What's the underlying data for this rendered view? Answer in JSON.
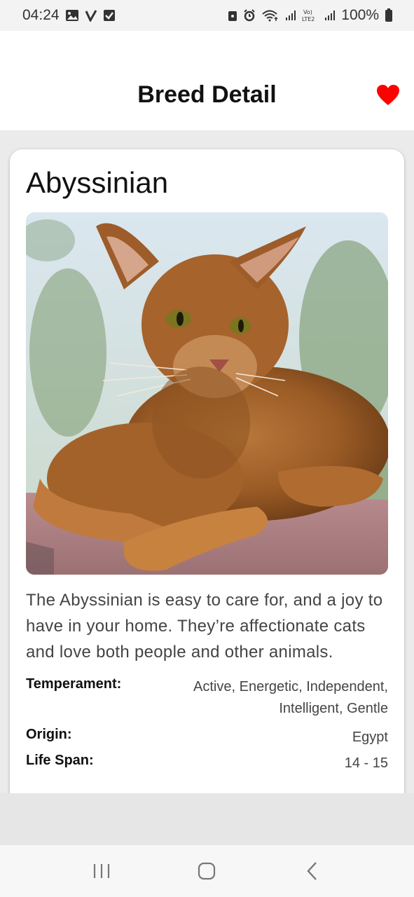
{
  "status_bar": {
    "time": "04:24",
    "battery": "100%",
    "icons_left": [
      "gallery-icon",
      "check-v-icon",
      "checkbox-icon"
    ],
    "icons_right": [
      "lock-icon",
      "alarm-icon",
      "wifi-icon",
      "signal-icon",
      "volte-lte2-icon",
      "signal-icon",
      "battery-icon"
    ]
  },
  "app_bar": {
    "title": "Breed Detail",
    "favorite_icon": "heart-icon",
    "favorite_color": "#ff0000"
  },
  "breed": {
    "name": "Abyssinian",
    "description": "The Abyssinian is easy to care for, and a joy to have in your home. They’re affectionate cats and love both people and other animals.",
    "details": [
      {
        "label": "Temperament:",
        "value": "Active, Energetic, Independent, Intelligent, Gentle"
      },
      {
        "label": "Origin:",
        "value": "Egypt"
      },
      {
        "label": "Life Span:",
        "value": "14 - 15"
      }
    ]
  },
  "nav_bar": {
    "items": [
      "recents-icon",
      "home-icon",
      "back-icon"
    ]
  }
}
